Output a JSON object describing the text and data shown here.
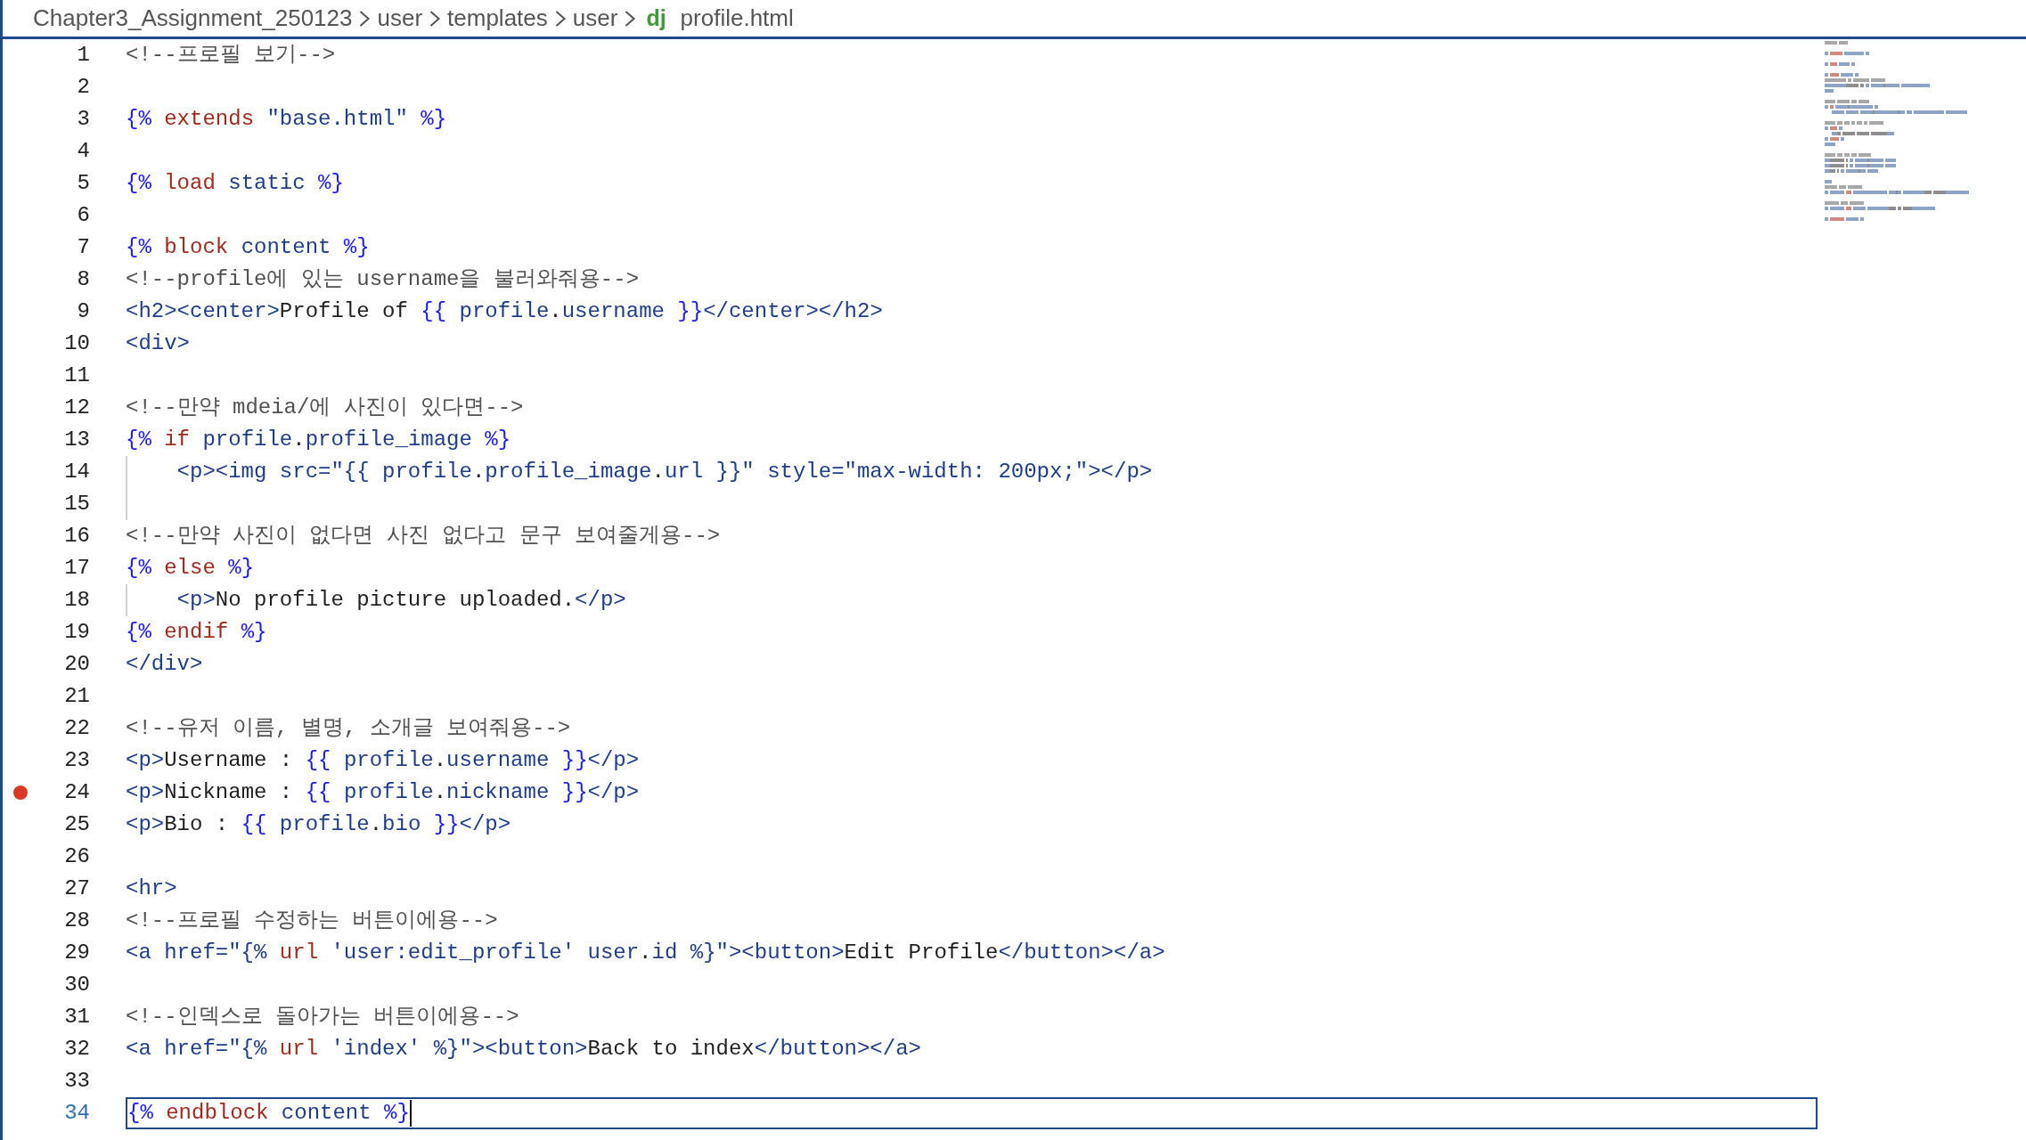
{
  "breadcrumb": {
    "folders": [
      "Chapter3_Assignment_250123",
      "user",
      "templates",
      "user"
    ],
    "file_badge": "dj",
    "file_name": "profile.html"
  },
  "lines": [
    {
      "number": "1",
      "breakpoint": false,
      "current": false,
      "indent_guide": false,
      "tokens": [
        {
          "kind": "comment",
          "text": "<!--프로필 보기-->"
        }
      ]
    },
    {
      "number": "2",
      "breakpoint": false,
      "current": false,
      "indent_guide": false
    },
    {
      "number": "3",
      "breakpoint": false,
      "current": false,
      "indent_guide": false,
      "tokens": [
        {
          "kind": "delim",
          "text": "{% "
        },
        {
          "kind": "keyword",
          "text": "extends"
        },
        {
          "kind": "markup",
          "text": " \"base.html\" "
        },
        {
          "kind": "delim",
          "text": "%}"
        }
      ]
    },
    {
      "number": "4",
      "breakpoint": false,
      "current": false,
      "indent_guide": false
    },
    {
      "number": "5",
      "breakpoint": false,
      "current": false,
      "indent_guide": false,
      "tokens": [
        {
          "kind": "delim",
          "text": "{% "
        },
        {
          "kind": "keyword",
          "text": "load"
        },
        {
          "kind": "markup",
          "text": " static "
        },
        {
          "kind": "delim",
          "text": "%}"
        }
      ]
    },
    {
      "number": "6",
      "breakpoint": false,
      "current": false,
      "indent_guide": false
    },
    {
      "number": "7",
      "breakpoint": false,
      "current": false,
      "indent_guide": false,
      "tokens": [
        {
          "kind": "delim",
          "text": "{% "
        },
        {
          "kind": "keyword",
          "text": "block"
        },
        {
          "kind": "markup",
          "text": " content "
        },
        {
          "kind": "delim",
          "text": "%}"
        }
      ]
    },
    {
      "number": "8",
      "breakpoint": false,
      "current": false,
      "indent_guide": false,
      "tokens": [
        {
          "kind": "comment",
          "text": "<!--profile에 있는 username을 불러와줘용-->"
        }
      ]
    },
    {
      "number": "9",
      "breakpoint": false,
      "current": false,
      "indent_guide": false,
      "tokens": [
        {
          "kind": "markup",
          "text": "<h2><center>"
        },
        {
          "kind": "plain",
          "text": "Profile of "
        },
        {
          "kind": "delim",
          "text": "{{ "
        },
        {
          "kind": "markup",
          "text": "profile"
        },
        {
          "kind": "plain",
          "text": "."
        },
        {
          "kind": "markup",
          "text": "username "
        },
        {
          "kind": "delim",
          "text": "}}"
        },
        {
          "kind": "markup",
          "text": "</center></h2>"
        }
      ]
    },
    {
      "number": "10",
      "breakpoint": false,
      "current": false,
      "indent_guide": false,
      "tokens": [
        {
          "kind": "markup",
          "text": "<div>"
        }
      ]
    },
    {
      "number": "11",
      "breakpoint": false,
      "current": false,
      "indent_guide": false
    },
    {
      "number": "12",
      "breakpoint": false,
      "current": false,
      "indent_guide": false,
      "tokens": [
        {
          "kind": "comment",
          "text": "<!--만약 mdeia/에 사진이 있다면-->"
        }
      ]
    },
    {
      "number": "13",
      "breakpoint": false,
      "current": false,
      "indent_guide": false,
      "tokens": [
        {
          "kind": "delim",
          "text": "{% "
        },
        {
          "kind": "keyword",
          "text": "if"
        },
        {
          "kind": "markup",
          "text": " profile"
        },
        {
          "kind": "plain",
          "text": "."
        },
        {
          "kind": "markup",
          "text": "profile_image "
        },
        {
          "kind": "delim",
          "text": "%}"
        }
      ]
    },
    {
      "number": "14",
      "breakpoint": false,
      "current": false,
      "indent_guide": true,
      "tokens": [
        {
          "kind": "markup",
          "text": "    <p><img src=\"{{ profile"
        },
        {
          "kind": "plain",
          "text": "."
        },
        {
          "kind": "markup",
          "text": "profile_image"
        },
        {
          "kind": "plain",
          "text": "."
        },
        {
          "kind": "markup",
          "text": "url }}\" style=\"max-width: 200px;\"></p>"
        }
      ]
    },
    {
      "number": "15",
      "breakpoint": false,
      "current": false,
      "indent_guide": true
    },
    {
      "number": "16",
      "breakpoint": false,
      "current": false,
      "indent_guide": false,
      "tokens": [
        {
          "kind": "comment",
          "text": "<!--만약 사진이 없다면 사진 없다고 문구 보여줄게용-->"
        }
      ]
    },
    {
      "number": "17",
      "breakpoint": false,
      "current": false,
      "indent_guide": false,
      "tokens": [
        {
          "kind": "delim",
          "text": "{% "
        },
        {
          "kind": "keyword",
          "text": "else"
        },
        {
          "kind": "delim",
          "text": " %}"
        }
      ]
    },
    {
      "number": "18",
      "breakpoint": false,
      "current": false,
      "indent_guide": true,
      "tokens": [
        {
          "kind": "markup",
          "text": "    <p>"
        },
        {
          "kind": "plain",
          "text": "No profile picture uploaded."
        },
        {
          "kind": "markup",
          "text": "</p>"
        }
      ]
    },
    {
      "number": "19",
      "breakpoint": false,
      "current": false,
      "indent_guide": false,
      "tokens": [
        {
          "kind": "delim",
          "text": "{% "
        },
        {
          "kind": "keyword",
          "text": "endif"
        },
        {
          "kind": "delim",
          "text": " %}"
        }
      ]
    },
    {
      "number": "20",
      "breakpoint": false,
      "current": false,
      "indent_guide": false,
      "tokens": [
        {
          "kind": "markup",
          "text": "</div>"
        }
      ]
    },
    {
      "number": "21",
      "breakpoint": false,
      "current": false,
      "indent_guide": false
    },
    {
      "number": "22",
      "breakpoint": false,
      "current": false,
      "indent_guide": false,
      "tokens": [
        {
          "kind": "comment",
          "text": "<!--유저 이름, 별명, 소개글 보여줘용-->"
        }
      ]
    },
    {
      "number": "23",
      "breakpoint": false,
      "current": false,
      "indent_guide": false,
      "tokens": [
        {
          "kind": "markup",
          "text": "<p>"
        },
        {
          "kind": "plain",
          "text": "Username : "
        },
        {
          "kind": "delim",
          "text": "{{ "
        },
        {
          "kind": "markup",
          "text": "profile"
        },
        {
          "kind": "plain",
          "text": "."
        },
        {
          "kind": "markup",
          "text": "username "
        },
        {
          "kind": "delim",
          "text": "}}"
        },
        {
          "kind": "markup",
          "text": "</p>"
        }
      ]
    },
    {
      "number": "24",
      "breakpoint": true,
      "current": false,
      "indent_guide": false,
      "tokens": [
        {
          "kind": "markup",
          "text": "<p>"
        },
        {
          "kind": "plain",
          "text": "Nickname : "
        },
        {
          "kind": "delim",
          "text": "{{ "
        },
        {
          "kind": "markup",
          "text": "profile"
        },
        {
          "kind": "plain",
          "text": "."
        },
        {
          "kind": "markup",
          "text": "nickname "
        },
        {
          "kind": "delim",
          "text": "}}"
        },
        {
          "kind": "markup",
          "text": "</p>"
        }
      ]
    },
    {
      "number": "25",
      "breakpoint": false,
      "current": false,
      "indent_guide": false,
      "tokens": [
        {
          "kind": "markup",
          "text": "<p>"
        },
        {
          "kind": "plain",
          "text": "Bio : "
        },
        {
          "kind": "delim",
          "text": "{{ "
        },
        {
          "kind": "markup",
          "text": "profile"
        },
        {
          "kind": "plain",
          "text": "."
        },
        {
          "kind": "markup",
          "text": "bio "
        },
        {
          "kind": "delim",
          "text": "}}"
        },
        {
          "kind": "markup",
          "text": "</p>"
        }
      ]
    },
    {
      "number": "26",
      "breakpoint": false,
      "current": false,
      "indent_guide": false
    },
    {
      "number": "27",
      "breakpoint": false,
      "current": false,
      "indent_guide": false,
      "tokens": [
        {
          "kind": "markup",
          "text": "<hr>"
        }
      ]
    },
    {
      "number": "28",
      "breakpoint": false,
      "current": false,
      "indent_guide": false,
      "tokens": [
        {
          "kind": "comment",
          "text": "<!--프로필 수정하는 버튼이에용-->"
        }
      ]
    },
    {
      "number": "29",
      "breakpoint": false,
      "current": false,
      "indent_guide": false,
      "tokens": [
        {
          "kind": "markup",
          "text": "<a href=\"{% "
        },
        {
          "kind": "keyword",
          "text": "url"
        },
        {
          "kind": "markup",
          "text": " 'user:edit_profile' user"
        },
        {
          "kind": "plain",
          "text": "."
        },
        {
          "kind": "markup",
          "text": "id %}\"><button>"
        },
        {
          "kind": "plain",
          "text": "Edit Profile"
        },
        {
          "kind": "markup",
          "text": "</button></a>"
        }
      ]
    },
    {
      "number": "30",
      "breakpoint": false,
      "current": false,
      "indent_guide": false
    },
    {
      "number": "31",
      "breakpoint": false,
      "current": false,
      "indent_guide": false,
      "tokens": [
        {
          "kind": "comment",
          "text": "<!--인덱스로 돌아가는 버튼이에용-->"
        }
      ]
    },
    {
      "number": "32",
      "breakpoint": false,
      "current": false,
      "indent_guide": false,
      "tokens": [
        {
          "kind": "markup",
          "text": "<a href=\"{% "
        },
        {
          "kind": "keyword",
          "text": "url"
        },
        {
          "kind": "markup",
          "text": " 'index' %}\"><button>"
        },
        {
          "kind": "plain",
          "text": "Back to index"
        },
        {
          "kind": "markup",
          "text": "</button></a>"
        }
      ]
    },
    {
      "number": "33",
      "breakpoint": false,
      "current": false,
      "indent_guide": false
    },
    {
      "number": "34",
      "breakpoint": false,
      "current": true,
      "indent_guide": false,
      "tokens": [
        {
          "kind": "delim",
          "text": "{% "
        },
        {
          "kind": "keyword",
          "text": "endblock"
        },
        {
          "kind": "markup",
          "text": " content "
        },
        {
          "kind": "delim",
          "text": "%}"
        }
      ]
    }
  ]
}
